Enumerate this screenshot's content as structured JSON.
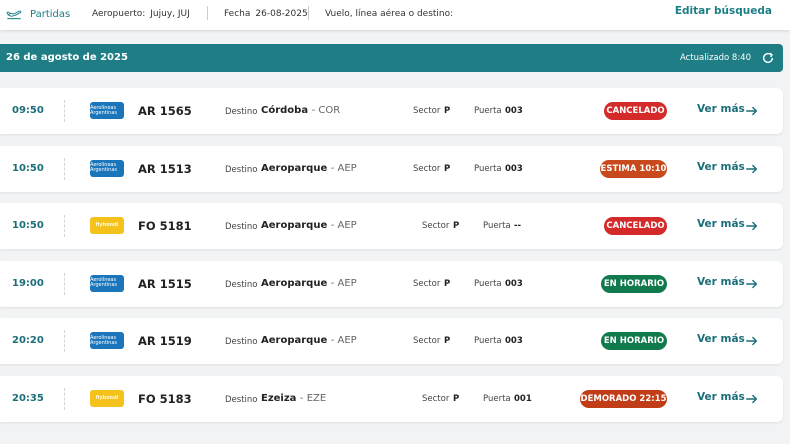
{
  "header": {
    "mode_label": "Partidas",
    "airport_label": "Aeropuerto:",
    "airport_value": "Jujuy, JUJ",
    "date_label": "Fecha",
    "date_value": "26-08-2025",
    "search_label": "Vuelo, línea aérea o destino:",
    "edit_label": "Editar búsqueda"
  },
  "date_bar": {
    "date": "26 de agosto de 2025",
    "updated": "Actualizado 8:40"
  },
  "labels": {
    "destination": "Destino",
    "sector": "Sector",
    "gate": "Puerta",
    "more": "Ver más"
  },
  "colors": {
    "accent": "#1e7d85",
    "cancelled": "#d42a2a",
    "estimated": "#c8491b",
    "on_time": "#117a4d",
    "delayed": "#c13d17"
  },
  "flights": [
    {
      "time": "09:50",
      "airline": "AR",
      "logo_text": "Aerolíneas Argentinas",
      "code": "AR 1565",
      "city": "Córdoba",
      "city_code": "- COR",
      "sector": "P",
      "gate": "003",
      "status": "CANCELADO",
      "status_type": "cancelled"
    },
    {
      "time": "10:50",
      "airline": "AR",
      "logo_text": "Aerolíneas Argentinas",
      "code": "AR 1513",
      "city": "Aeroparque",
      "city_code": "- AEP",
      "sector": "P",
      "gate": "003",
      "status": "ESTIMA 10:10",
      "status_type": "estimated"
    },
    {
      "time": "10:50",
      "airline": "FO",
      "logo_text": "flybondi",
      "code": "FO 5181",
      "city": "Aeroparque",
      "city_code": "- AEP",
      "sector": "P",
      "gate": "--",
      "status": "CANCELADO",
      "status_type": "cancelled"
    },
    {
      "time": "19:00",
      "airline": "AR",
      "logo_text": "Aerolíneas Argentinas",
      "code": "AR 1515",
      "city": "Aeroparque",
      "city_code": "- AEP",
      "sector": "P",
      "gate": "003",
      "status": "EN HORARIO",
      "status_type": "on_time"
    },
    {
      "time": "20:20",
      "airline": "AR",
      "logo_text": "Aerolíneas Argentinas",
      "code": "AR 1519",
      "city": "Aeroparque",
      "city_code": "- AEP",
      "sector": "P",
      "gate": "003",
      "status": "EN HORARIO",
      "status_type": "on_time"
    },
    {
      "time": "20:35",
      "airline": "FO",
      "logo_text": "flybondi",
      "code": "FO 5183",
      "city": "Ezeiza",
      "city_code": "- EZE",
      "sector": "P",
      "gate": "001",
      "status": "DEMORADO 22:15",
      "status_type": "delayed"
    }
  ]
}
